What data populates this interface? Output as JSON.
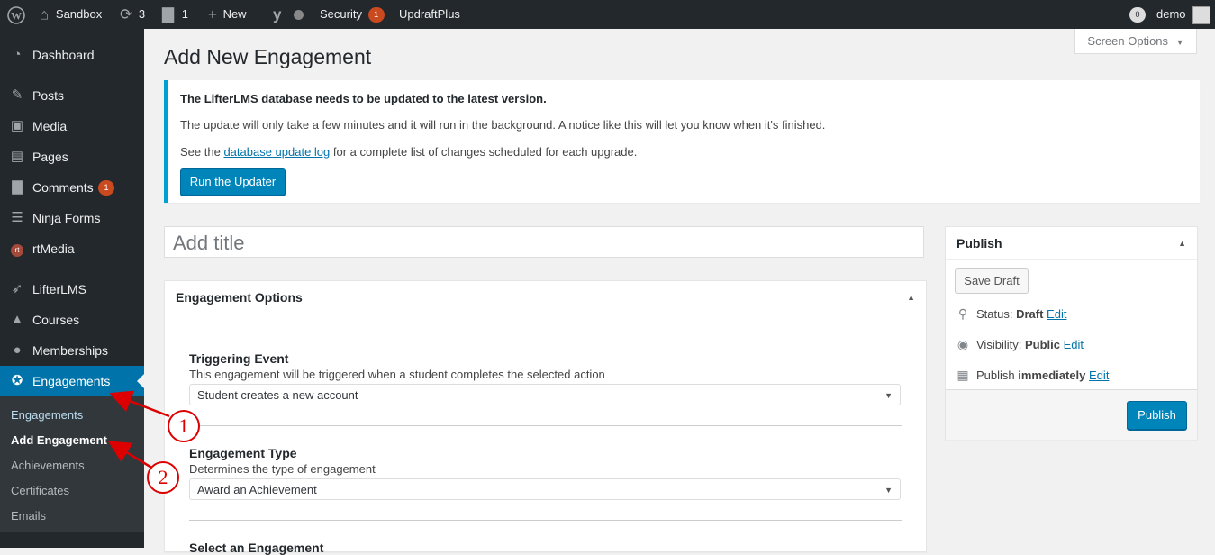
{
  "admin_bar": {
    "site_name": "Sandbox",
    "updates_count": "3",
    "comments_count": "1",
    "new_label": "New",
    "security_label": "Security",
    "security_count": "1",
    "updraft_label": "UpdraftPlus",
    "notif_count": "0",
    "user_name": "demo"
  },
  "sidebar": {
    "items": [
      {
        "label": "Dashboard",
        "icon": "dashboard-icon"
      },
      {
        "label": "Posts",
        "icon": "pin-icon"
      },
      {
        "label": "Media",
        "icon": "media-icon"
      },
      {
        "label": "Pages",
        "icon": "pages-icon"
      },
      {
        "label": "Comments",
        "icon": "comment-icon",
        "badge": "1"
      },
      {
        "label": "Ninja Forms",
        "icon": "forms-icon"
      },
      {
        "label": "rtMedia",
        "icon": "rtmedia-icon"
      },
      {
        "label": "LifterLMS",
        "icon": "rocket-icon"
      },
      {
        "label": "Courses",
        "icon": "mortarboard-icon"
      },
      {
        "label": "Memberships",
        "icon": "groups-icon"
      },
      {
        "label": "Engagements",
        "icon": "award-icon"
      }
    ],
    "submenu": [
      "Engagements",
      "Add Engagement",
      "Achievements",
      "Certificates",
      "Emails"
    ]
  },
  "screen_options": "Screen Options",
  "page_title": "Add New Engagement",
  "notice": {
    "heading": "The LifterLMS database needs to be updated to the latest version.",
    "line1": "The update will only take a few minutes and it will run in the background. A notice like this will let you know when it's finished.",
    "line2_pre": "See the ",
    "line2_link": "database update log",
    "line2_post": " for a complete list of changes scheduled for each upgrade.",
    "button": "Run the Updater"
  },
  "title_placeholder": "Add title",
  "engagement_options": {
    "heading": "Engagement Options",
    "fields": [
      {
        "title": "Triggering Event",
        "desc": "This engagement will be triggered when a student completes the selected action",
        "value": "Student creates a new account"
      },
      {
        "title": "Engagement Type",
        "desc": "Determines the type of engagement",
        "value": "Award an Achievement"
      },
      {
        "title": "Select an Engagement"
      }
    ]
  },
  "publish": {
    "heading": "Publish",
    "save_draft": "Save Draft",
    "status_label": "Status: ",
    "status_value": "Draft",
    "visibility_label": "Visibility: ",
    "visibility_value": "Public",
    "publish_label": "Publish ",
    "publish_value": "immediately",
    "edit": "Edit",
    "button": "Publish"
  },
  "annotations": [
    "1",
    "2"
  ],
  "colors": {
    "accent": "#0073aa",
    "annotation": "#dd0000",
    "sidebar_bg": "#23282d"
  }
}
